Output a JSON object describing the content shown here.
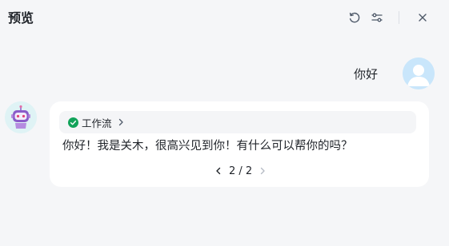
{
  "header": {
    "title": "预览"
  },
  "icons": {
    "reset": "refresh-icon",
    "settings": "sliders-icon",
    "close": "close-icon",
    "check": "check-circle-icon",
    "user_avatar": "person-avatar-icon",
    "bot_avatar": "robot-avatar-icon"
  },
  "colors": {
    "check_green": "#12a35a",
    "user_avatar_bg": "#c9e6fb",
    "bot_avatar_bg": "#dff3f5",
    "bot_avatar_accent": "#8a5cc9"
  },
  "conversation": {
    "user_message": "你好",
    "bot": {
      "workflow_label": "工作流",
      "message": "你好！我是关木，很高兴见到你！有什么可以帮你的吗？",
      "pagination": "2 / 2"
    }
  }
}
